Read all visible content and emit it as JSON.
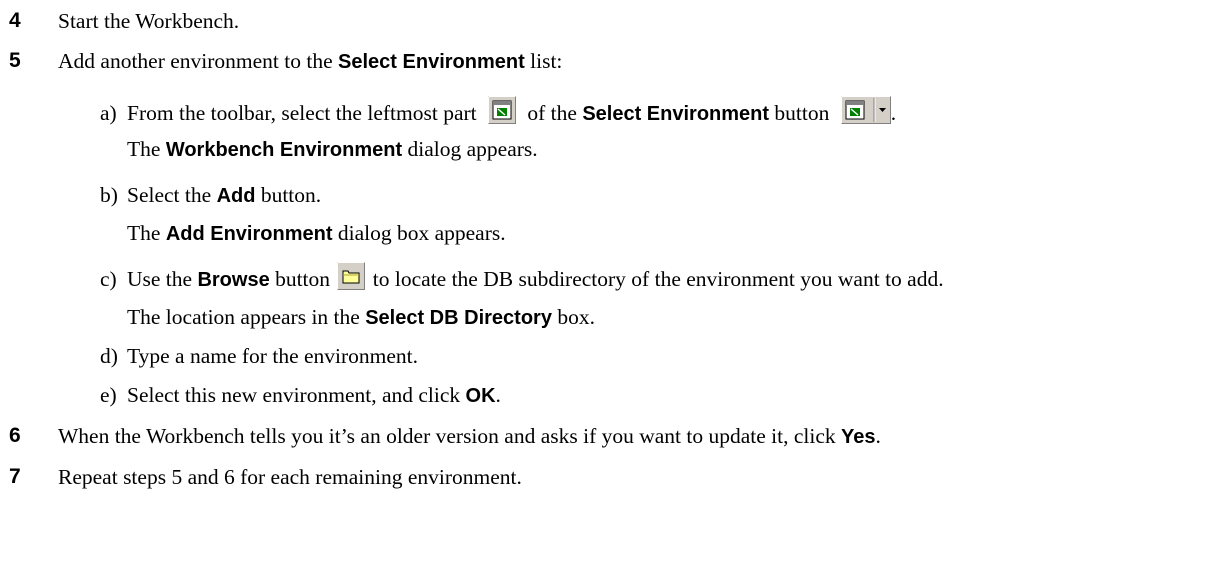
{
  "steps": [
    {
      "num": "4",
      "text": "Start the Workbench."
    },
    {
      "num": "5",
      "pre": "Add another environment to the ",
      "bold": "Select Environment",
      "post": " list:"
    },
    {
      "num": "6",
      "pre": "When the Workbench tells you it’s an older version and asks if you want to update it, click ",
      "bold": "Yes",
      "post": "."
    },
    {
      "num": "7",
      "text": "Repeat steps 5 and 6 for each remaining environment."
    }
  ],
  "substeps": {
    "a": {
      "label": "a)",
      "pre": "From the toolbar, select the leftmost part ",
      "mid": " of the ",
      "bold": "Select Environment",
      "post": " button ",
      "end": ".",
      "result_pre": "The ",
      "result_bold": "Workbench Environment",
      "result_post": " dialog appears."
    },
    "b": {
      "label": "b)",
      "pre": "Select the ",
      "bold": "Add",
      "post": " button.",
      "result_pre": "The ",
      "result_bold": "Add Environment",
      "result_post": " dialog box appears."
    },
    "c": {
      "label": "c)",
      "pre": "Use the ",
      "bold": "Browse",
      "post": " button ",
      "post2": " to locate the DB subdirectory of the environment you want to add.",
      "result_pre": "The location appears in the ",
      "result_bold": "Select DB Directory",
      "result_post": " box."
    },
    "d": {
      "label": "d)",
      "text": "Type a name for the environment."
    },
    "e": {
      "label": "e)",
      "pre": "Select this new environment, and click ",
      "bold": "OK",
      "post": "."
    }
  },
  "icons": {
    "env_icon": "select-environment-icon",
    "env_dropdown": "chevron-down-icon",
    "browse_icon": "folder-icon"
  }
}
